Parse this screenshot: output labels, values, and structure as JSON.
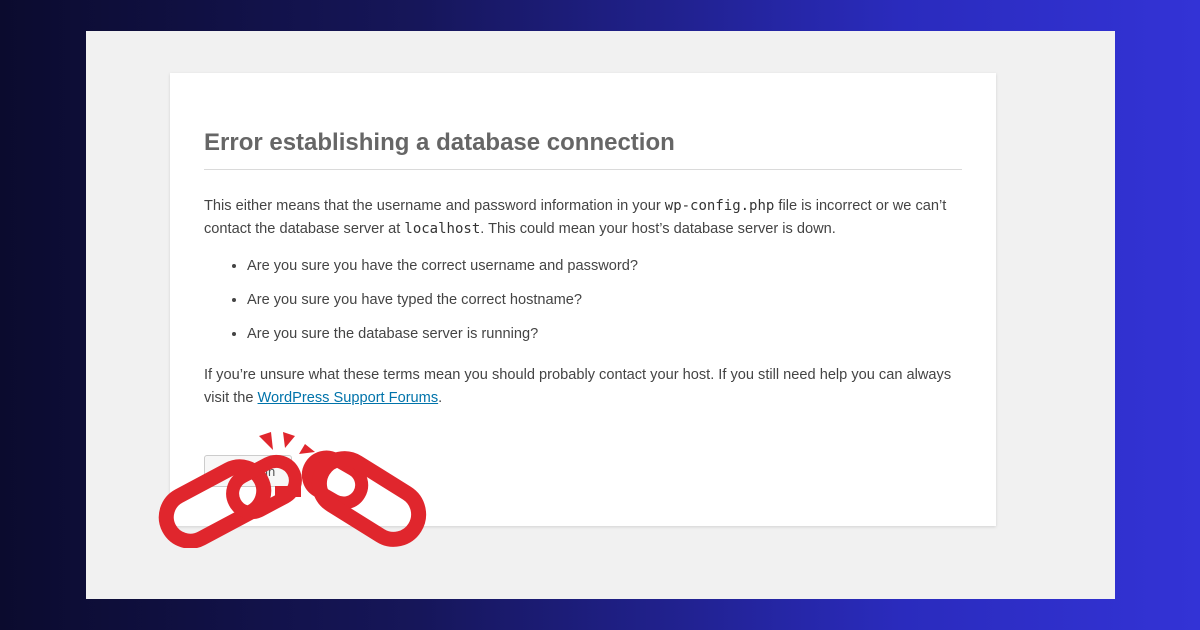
{
  "error_page": {
    "title": "Error establishing a database connection",
    "intro": {
      "part1": "This either means that the username and password information in your ",
      "config_file": "wp-config.php",
      "part2": " file is incorrect or we can’t contact the database server at ",
      "host": "localhost",
      "part3": ". This could mean your host’s database server is down."
    },
    "questions": [
      "Are you sure you have the correct username and password?",
      "Are you sure you have typed the correct hostname?",
      "Are you sure the database server is running?"
    ],
    "help": {
      "part1": "If you’re unsure what these terms mean you should probably contact your host. If you still need help you can always visit the ",
      "link_text": "WordPress Support Forums",
      "part2": "."
    },
    "try_again_label": "Try Again"
  },
  "overlay": {
    "icon": "broken-chain-icon",
    "color": "#e0262d"
  },
  "colors": {
    "link": "#0073aa",
    "title": "#666666",
    "background_gradient_start": "#0b0b2e",
    "background_gradient_end": "#3333d6"
  }
}
